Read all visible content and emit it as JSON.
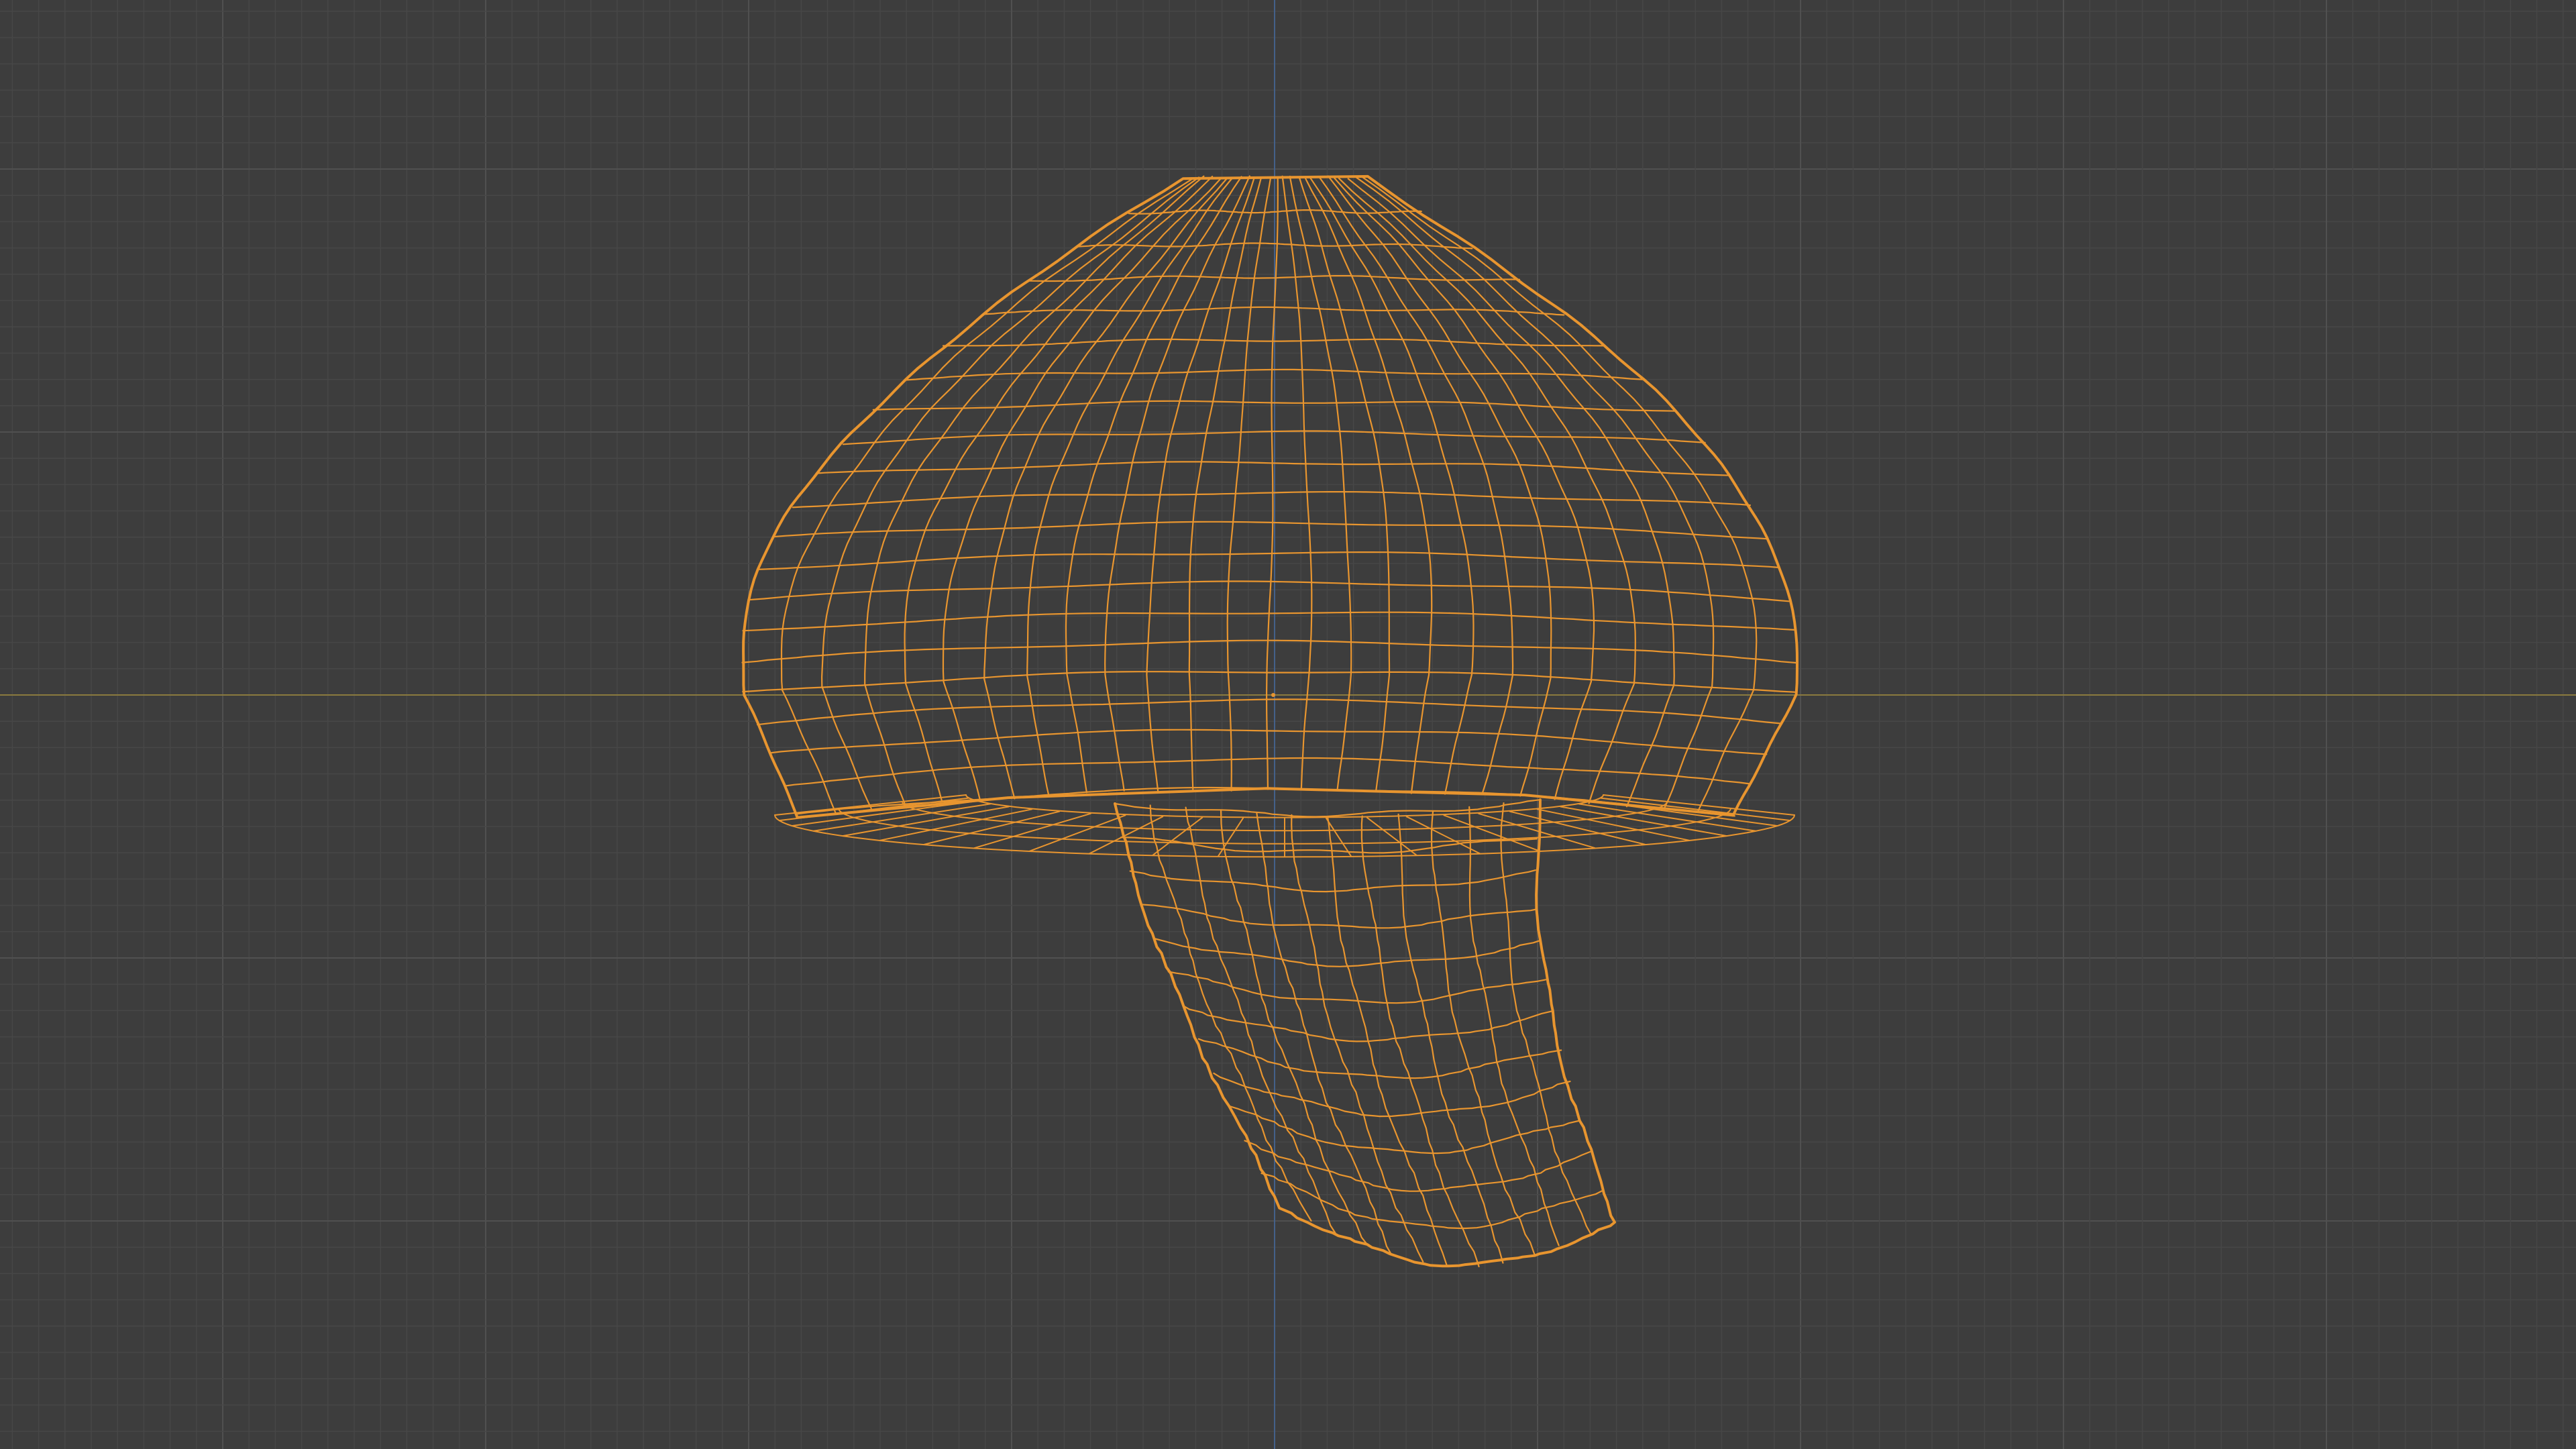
{
  "viewport": {
    "view": "3d-viewport-wireframe",
    "shading_mode": "wireframe",
    "background_color": "#3d3d3d",
    "grid": {
      "visible": true,
      "minor_color": "#474747",
      "major_color": "#505050"
    },
    "axes": {
      "x_axis_color": "#8a7a3e",
      "z_axis_color": "#44618a"
    }
  },
  "object": {
    "name_icon": "mushroom-mesh",
    "selected": true,
    "wire_color": "#e8952f",
    "origin_marker_color": "#e8952f"
  }
}
